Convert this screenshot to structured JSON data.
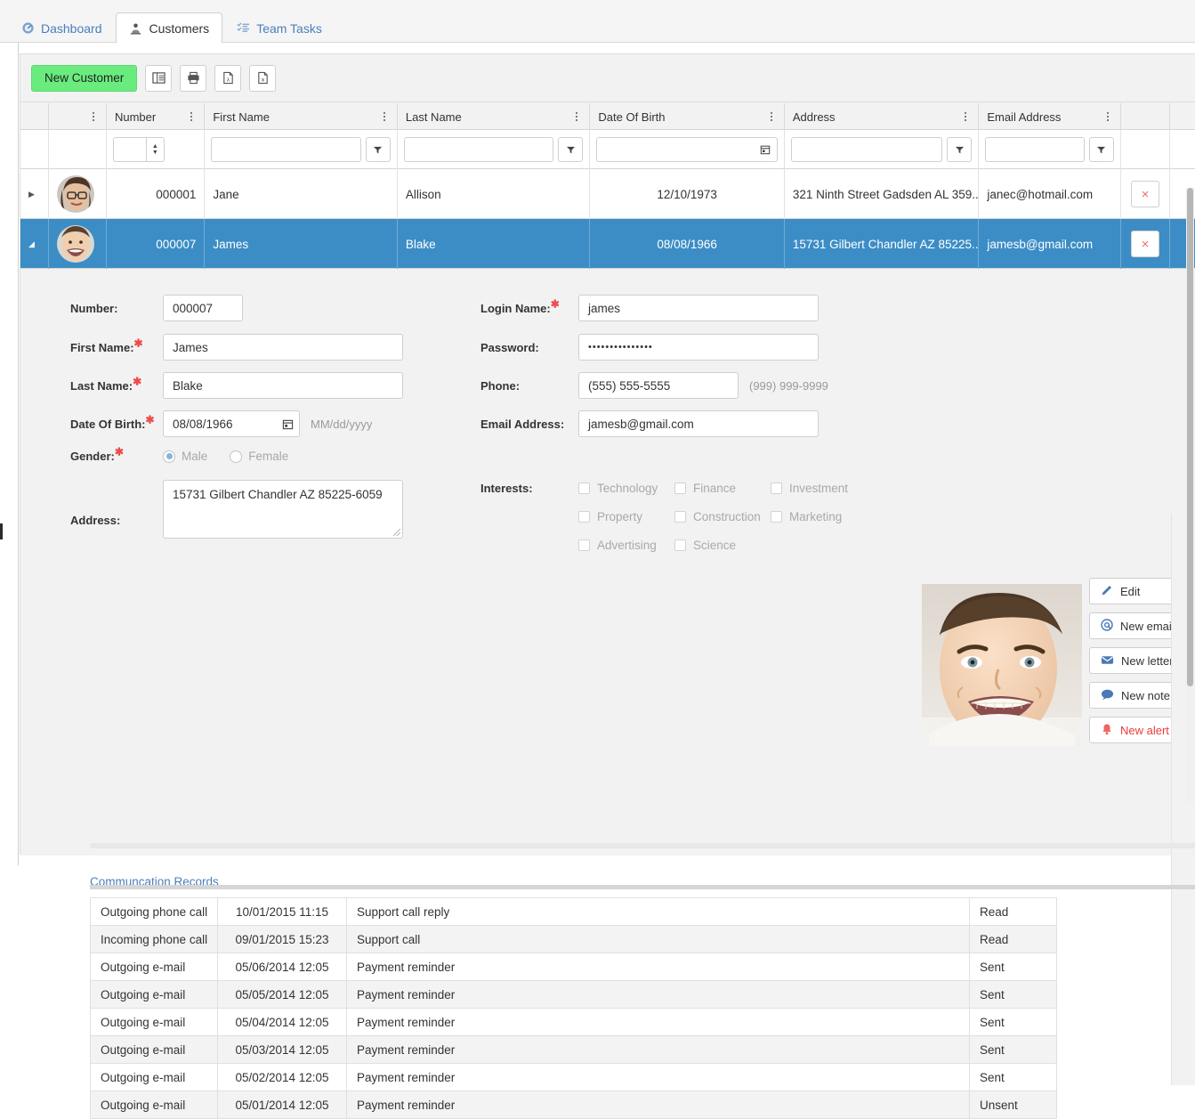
{
  "tabs": [
    {
      "label": "Dashboard",
      "icon": "gauge-icon",
      "active": false
    },
    {
      "label": "Customers",
      "icon": "customers-icon",
      "active": true
    },
    {
      "label": "Team Tasks",
      "icon": "tasks-list-icon",
      "active": false
    }
  ],
  "toolbar": {
    "new_customer_label": "New Customer",
    "buttons": [
      {
        "name": "column-chooser-icon",
        "title": "Column chooser"
      },
      {
        "name": "print-icon",
        "title": "Print"
      },
      {
        "name": "export-pdf-icon",
        "title": "Export PDF"
      },
      {
        "name": "export-excel-icon",
        "title": "Export Excel"
      }
    ],
    "accent_green": "#69ec7d"
  },
  "grid": {
    "columns": [
      {
        "key": "number",
        "label": "Number",
        "filter": "spinner"
      },
      {
        "key": "first_name",
        "label": "First Name",
        "filter": "text"
      },
      {
        "key": "last_name",
        "label": "Last Name",
        "filter": "text"
      },
      {
        "key": "dob",
        "label": "Date Of Birth",
        "filter": "date"
      },
      {
        "key": "address",
        "label": "Address",
        "filter": "text"
      },
      {
        "key": "email",
        "label": "Email Address",
        "filter": "text"
      }
    ],
    "filter_values": {
      "number": "",
      "first_name": "",
      "last_name": "",
      "dob": "",
      "address": "",
      "email": ""
    },
    "rows": [
      {
        "expander": "▶",
        "number": "000001",
        "first_name": "Jane",
        "last_name": "Allison",
        "dob": "12/10/1973",
        "address": "321 Ninth Street Gadsden AL 359...",
        "email": "janec@hotmail.com",
        "delete_label": "×",
        "selected": false
      },
      {
        "expander": "◢",
        "number": "000007",
        "first_name": "James",
        "last_name": "Blake",
        "dob": "08/08/1966",
        "address": "15731 Gilbert Chandler AZ 85225...",
        "email": "jamesb@gmail.com",
        "delete_label": "×",
        "selected": true
      }
    ],
    "selected_row_color": "#3c8dc5"
  },
  "detail": {
    "left": {
      "number_label": "Number:",
      "number_value": "000007",
      "first_name_label": "First Name:",
      "first_name_value": "James",
      "last_name_label": "Last Name:",
      "last_name_value": "Blake",
      "dob_label": "Date Of Birth:",
      "dob_value": "08/08/1966",
      "dob_format_hint": "MM/dd/yyyy",
      "gender_label": "Gender:",
      "gender_male": "Male",
      "gender_female": "Female",
      "gender_selected": "Male",
      "address_label": "Address:",
      "address_value": "15731 Gilbert Chandler AZ 85225-6059"
    },
    "right": {
      "login_label": "Login Name:",
      "login_value": "james",
      "password_label": "Password:",
      "password_value": "•••••••••••••••",
      "phone_label": "Phone:",
      "phone_value": "(555) 555-5555",
      "phone_mask_hint": "(999) 999-9999",
      "email_label": "Email Address:",
      "email_value": "jamesb@gmail.com",
      "interests_label": "Interests:",
      "interests": [
        "Technology",
        "Finance",
        "Investment",
        "Property",
        "Construction",
        "Marketing",
        "Advertising",
        "Science"
      ]
    },
    "actions": [
      {
        "label": "Edit",
        "icon": "pencil-icon",
        "alert": false
      },
      {
        "label": "New email",
        "icon": "at-sign-icon",
        "alert": false
      },
      {
        "label": "New letter",
        "icon": "envelope-icon",
        "alert": false
      },
      {
        "label": "New note",
        "icon": "speech-bubble-icon",
        "alert": false
      },
      {
        "label": "New alert",
        "icon": "bell-icon",
        "alert": true
      }
    ]
  },
  "communication": {
    "title": "Communcation Records",
    "rows": [
      {
        "type": "Outgoing phone call",
        "datetime": "10/01/2015 11:15",
        "subject": "Support call reply",
        "status": "Read",
        "status_class": "st-read"
      },
      {
        "type": "Incoming phone call",
        "datetime": "09/01/2015 15:23",
        "subject": "Support call",
        "status": "Read",
        "status_class": "st-read"
      },
      {
        "type": "Outgoing e-mail",
        "datetime": "05/06/2014 12:05",
        "subject": "Payment reminder",
        "status": "Sent",
        "status_class": "st-sent"
      },
      {
        "type": "Outgoing e-mail",
        "datetime": "05/05/2014 12:05",
        "subject": "Payment reminder",
        "status": "Sent",
        "status_class": "st-sent"
      },
      {
        "type": "Outgoing e-mail",
        "datetime": "05/04/2014 12:05",
        "subject": "Payment reminder",
        "status": "Sent",
        "status_class": "st-sent"
      },
      {
        "type": "Outgoing e-mail",
        "datetime": "05/03/2014 12:05",
        "subject": "Payment reminder",
        "status": "Sent",
        "status_class": "st-sent"
      },
      {
        "type": "Outgoing e-mail",
        "datetime": "05/02/2014 12:05",
        "subject": "Payment reminder",
        "status": "Sent",
        "status_class": "st-sent"
      },
      {
        "type": "Outgoing e-mail",
        "datetime": "05/01/2014 12:05",
        "subject": "Payment reminder",
        "status": "Unsent",
        "status_class": "st-unsent"
      }
    ]
  }
}
